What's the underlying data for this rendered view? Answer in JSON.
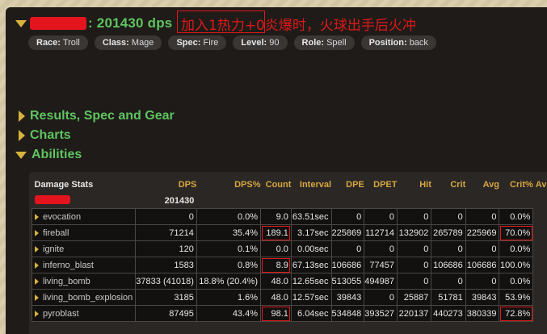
{
  "header": {
    "dps_title": ": 201430 dps",
    "annotation": "加入1热力+0炎爆时，火球出手后火冲"
  },
  "badges": [
    {
      "key": "Race:",
      "value": "Troll"
    },
    {
      "key": "Class:",
      "value": "Mage"
    },
    {
      "key": "Spec:",
      "value": "Fire"
    },
    {
      "key": "Level:",
      "value": "90"
    },
    {
      "key": "Role:",
      "value": "Spell"
    },
    {
      "key": "Position:",
      "value": "back"
    }
  ],
  "sections": {
    "results": "Results, Spec and Gear",
    "charts": "Charts",
    "abilities": "Abilities"
  },
  "table": {
    "headers": [
      "Damage Stats",
      "DPS",
      "DPS%",
      "Count",
      "Interval",
      "DPE",
      "DPET",
      "Hit",
      "Crit",
      "Avg",
      "Crit%",
      "Av"
    ],
    "total_dps": "201430",
    "rows": [
      {
        "name": "evocation",
        "cells": [
          "0",
          "0.0%",
          "9.0",
          "63.51sec",
          "0",
          "0",
          "0",
          "0",
          "0",
          "0.0%"
        ]
      },
      {
        "name": "fireball",
        "cells": [
          "71214",
          "35.4%",
          "189.1",
          "3.17sec",
          "225869",
          "112714",
          "132902",
          "265789",
          "225969",
          "70.0%"
        ]
      },
      {
        "name": "ignite",
        "cells": [
          "120",
          "0.1%",
          "0.0",
          "0.00sec",
          "0",
          "0",
          "0",
          "0",
          "0",
          "0.0%"
        ]
      },
      {
        "name": "inferno_blast",
        "cells": [
          "1583",
          "0.8%",
          "8.9",
          "67.13sec",
          "106686",
          "77457",
          "0",
          "106686",
          "106686",
          "100.0%"
        ]
      },
      {
        "name": "living_bomb",
        "cells": [
          "37833 (41018)",
          "18.8% (20.4%)",
          "48.0",
          "12.65sec",
          "513055",
          "494987",
          "0",
          "0",
          "0",
          "0.0%"
        ]
      },
      {
        "name": "living_bomb_explosion",
        "cells": [
          "3185",
          "1.6%",
          "48.0",
          "12.57sec",
          "39843",
          "0",
          "25887",
          "51781",
          "39843",
          "53.9%"
        ]
      },
      {
        "name": "pyroblast",
        "cells": [
          "87495",
          "43.4%",
          "98.1",
          "6.04sec",
          "534848",
          "393527",
          "220137",
          "440273",
          "380339",
          "72.8%"
        ]
      }
    ]
  }
}
